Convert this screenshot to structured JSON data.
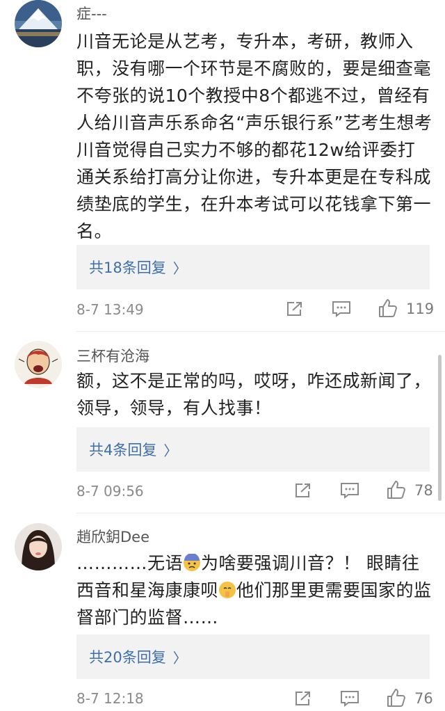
{
  "comments": [
    {
      "username": "症---",
      "content": "川音无论是从艺考，专升本，考研，教师入职，没有哪一个环节是不腐败的，要是细查毫不夸张的说10个教授中8个都逃不过，曾经有人给川音声乐系命名“声乐银行系”艺考生想考川音觉得自己实力不够的都花12w给评委打通关系给打高分让你进，专升本更是在专科成绩垫底的学生，在升本考试可以花钱拿下第一名。",
      "reply_text": "共18条回复",
      "time": "8-7 13:49",
      "likes": "119"
    },
    {
      "username": "三杯有沧海",
      "content": "额，这不是正常的吗，哎呀，咋还成新闻了，领导，领导，有人找事！",
      "reply_text": "共4条回复",
      "time": "8-7 09:56",
      "likes": "78"
    },
    {
      "username": "趙欣鈅Dee",
      "content_part1": "…………无语",
      "content_part2": "为啥要强调川音？！ 眼睛往西音和星海康康呗",
      "content_part3": "他们那里更需要国家的监督部门的监督……",
      "reply_text": "共20条回复",
      "time": "8-7 12:18",
      "likes": "76"
    }
  ],
  "colors": {
    "link": "#3f6fa8",
    "reply_bg": "#f2f2f2",
    "meta": "#8a8a8a"
  }
}
